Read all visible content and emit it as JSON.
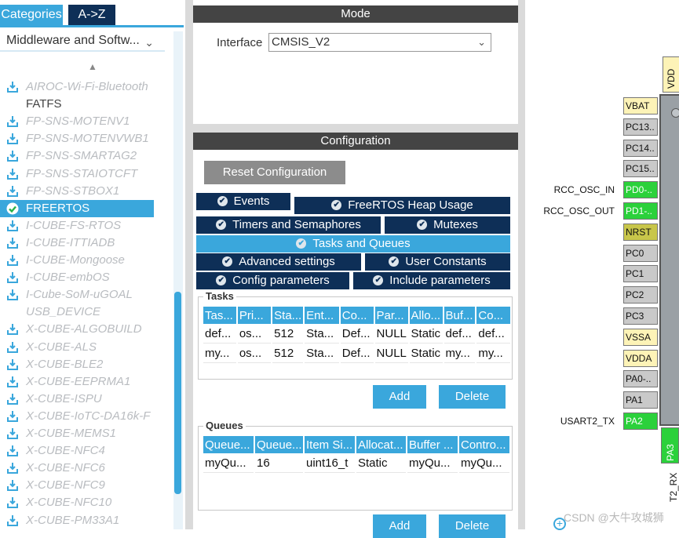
{
  "left_panel": {
    "tabs": [
      "Categories",
      "A->Z"
    ],
    "category_select": "Middleware and Softw...",
    "items": [
      {
        "label": "AIROC-Wi-Fi-Bluetooth",
        "icon": "download-icon",
        "state": "disabled"
      },
      {
        "label": "FATFS",
        "icon": "",
        "state": "plain"
      },
      {
        "label": "FP-SNS-MOTENV1",
        "icon": "download-icon",
        "state": "disabled"
      },
      {
        "label": "FP-SNS-MOTENVWB1",
        "icon": "download-icon",
        "state": "disabled"
      },
      {
        "label": "FP-SNS-SMARTAG2",
        "icon": "download-icon",
        "state": "disabled"
      },
      {
        "label": "FP-SNS-STAIOTCFT",
        "icon": "download-icon",
        "state": "disabled"
      },
      {
        "label": "FP-SNS-STBOX1",
        "icon": "download-icon",
        "state": "disabled"
      },
      {
        "label": "FREERTOS",
        "icon": "check-icon",
        "state": "selected"
      },
      {
        "label": "I-CUBE-FS-RTOS",
        "icon": "download-icon",
        "state": "disabled"
      },
      {
        "label": "I-CUBE-ITTIADB",
        "icon": "download-icon",
        "state": "disabled"
      },
      {
        "label": "I-CUBE-Mongoose",
        "icon": "download-icon",
        "state": "disabled"
      },
      {
        "label": "I-CUBE-embOS",
        "icon": "download-icon",
        "state": "disabled"
      },
      {
        "label": "I-Cube-SoM-uGOAL",
        "icon": "download-icon",
        "state": "disabled"
      },
      {
        "label": "USB_DEVICE",
        "icon": "",
        "state": "disabled"
      },
      {
        "label": "X-CUBE-ALGOBUILD",
        "icon": "download-icon",
        "state": "disabled"
      },
      {
        "label": "X-CUBE-ALS",
        "icon": "download-icon",
        "state": "disabled"
      },
      {
        "label": "X-CUBE-BLE2",
        "icon": "download-icon",
        "state": "disabled"
      },
      {
        "label": "X-CUBE-EEPRMA1",
        "icon": "download-icon",
        "state": "disabled"
      },
      {
        "label": "X-CUBE-ISPU",
        "icon": "download-icon",
        "state": "disabled"
      },
      {
        "label": "X-CUBE-IoTC-DA16k-F",
        "icon": "download-icon",
        "state": "disabled"
      },
      {
        "label": "X-CUBE-MEMS1",
        "icon": "download-icon",
        "state": "disabled"
      },
      {
        "label": "X-CUBE-NFC4",
        "icon": "download-icon",
        "state": "disabled"
      },
      {
        "label": "X-CUBE-NFC6",
        "icon": "download-icon",
        "state": "disabled"
      },
      {
        "label": "X-CUBE-NFC9",
        "icon": "download-icon",
        "state": "disabled"
      },
      {
        "label": "X-CUBE-NFC10",
        "icon": "download-icon",
        "state": "disabled"
      },
      {
        "label": "X-CUBE-PM33A1",
        "icon": "download-icon",
        "state": "disabled"
      }
    ]
  },
  "mode": {
    "title": "Mode",
    "interface_label": "Interface",
    "interface_value": "CMSIS_V2"
  },
  "configuration": {
    "title": "Configuration",
    "reset_label": "Reset Configuration",
    "tabs": [
      "Events",
      "FreeRTOS Heap Usage",
      "Timers and Semaphores",
      "Mutexes",
      "Tasks and Queues",
      "Advanced settings",
      "User Constants",
      "Config parameters",
      "Include parameters"
    ],
    "active_tab": "Tasks and Queues",
    "tasks": {
      "title": "Tasks",
      "headers": [
        "Tas...",
        "Pri...",
        "Sta...",
        "Ent...",
        "Co...",
        "Par...",
        "Allo...",
        "Buf...",
        "Co..."
      ],
      "rows": [
        [
          "def...",
          "os...",
          "512",
          "Sta...",
          "Def...",
          "NULL",
          "Static",
          "def...",
          "def..."
        ],
        [
          "my...",
          "os...",
          "512",
          "Sta...",
          "Def...",
          "NULL",
          "Static",
          "my...",
          "my..."
        ]
      ],
      "add_label": "Add",
      "delete_label": "Delete"
    },
    "queues": {
      "title": "Queues",
      "headers": [
        "Queue...",
        "Queue...",
        "Item Si...",
        "Allocat...",
        "Buffer ...",
        "Contro..."
      ],
      "rows": [
        [
          "myQu...",
          "16",
          "uint16_t",
          "Static",
          "myQu...",
          "myQu..."
        ]
      ],
      "add_label": "Add",
      "delete_label": "Delete"
    }
  },
  "pinout": {
    "top_pin": "VDD",
    "pins": [
      {
        "name": "VBAT",
        "signal": "",
        "color": "yellow"
      },
      {
        "name": "PC13..",
        "signal": "",
        "color": "gray"
      },
      {
        "name": "PC14..",
        "signal": "",
        "color": "gray"
      },
      {
        "name": "PC15..",
        "signal": "",
        "color": "gray"
      },
      {
        "name": "PD0-..",
        "signal": "RCC_OSC_IN",
        "color": "green"
      },
      {
        "name": "PD1-..",
        "signal": "RCC_OSC_OUT",
        "color": "green"
      },
      {
        "name": "NRST",
        "signal": "",
        "color": "olive"
      },
      {
        "name": "PC0",
        "signal": "",
        "color": "gray"
      },
      {
        "name": "PC1",
        "signal": "",
        "color": "gray"
      },
      {
        "name": "PC2",
        "signal": "",
        "color": "gray"
      },
      {
        "name": "PC3",
        "signal": "",
        "color": "gray"
      },
      {
        "name": "VSSA",
        "signal": "",
        "color": "yellow"
      },
      {
        "name": "VDDA",
        "signal": "",
        "color": "yellow"
      },
      {
        "name": "PA0-..",
        "signal": "",
        "color": "gray"
      },
      {
        "name": "PA1",
        "signal": "",
        "color": "gray"
      },
      {
        "name": "PA2",
        "signal": "USART2_TX",
        "color": "green"
      }
    ],
    "bottom_pin": "PA3",
    "bottom_signal": "T2_RX"
  },
  "watermark": "CSDN @大牛攻城狮",
  "colors": {
    "accent": "#3aa7dc",
    "navy": "#0e2f57",
    "header": "#444444",
    "pin_green": "#2bd13b",
    "pin_yellow": "#fdf3b7"
  }
}
